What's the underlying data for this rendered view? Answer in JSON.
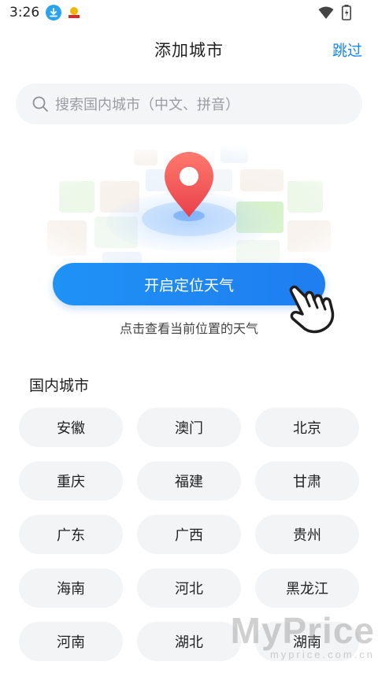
{
  "status_bar": {
    "time": "3:26",
    "icons": [
      "download-icon",
      "app-badge-icon",
      "wifi-icon",
      "battery-icon"
    ]
  },
  "header": {
    "title": "添加城市",
    "skip_label": "跳过"
  },
  "search": {
    "placeholder": "搜索国内城市（中文、拼音）"
  },
  "locate": {
    "button_label": "开启定位天气",
    "hint": "点击查看当前位置的天气"
  },
  "domestic": {
    "section_title": "国内城市",
    "cities": [
      "安徽",
      "澳门",
      "北京",
      "重庆",
      "福建",
      "甘肃",
      "广东",
      "广西",
      "贵州",
      "海南",
      "河北",
      "黑龙江",
      "河南",
      "湖北",
      "湖南"
    ]
  },
  "watermark": {
    "main": "MyPrice",
    "sub": "myprice.com.cn"
  },
  "colors": {
    "accent": "#1a88ee",
    "button": "#1f84f2",
    "pin": "#f05a5a",
    "chip_bg": "#f3f4f6"
  }
}
